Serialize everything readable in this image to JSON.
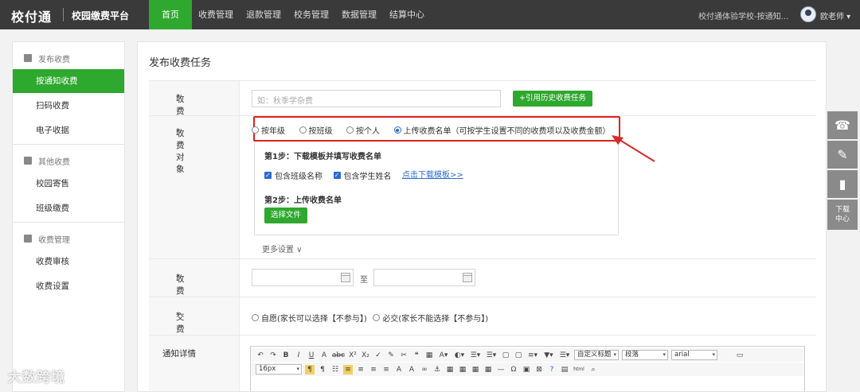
{
  "header": {
    "logo": "校付通",
    "platform": "校园缴费平台",
    "nav": [
      "首页",
      "收费管理",
      "退款管理",
      "校务管理",
      "数据管理",
      "结算中心"
    ],
    "school": "校付通体验学校-按通知...",
    "user": "欧老师 ▾"
  },
  "sidebar": {
    "groups": [
      {
        "label": "发布收费",
        "items": [
          "按通知收费",
          "扫码收费",
          "电子收据"
        ]
      },
      {
        "label": "其他收费",
        "items": [
          "校园寄售",
          "班级缴费"
        ]
      },
      {
        "label": "收费管理",
        "items": [
          "收费审核",
          "收费设置"
        ]
      }
    ]
  },
  "main": {
    "title": "发布收费任务",
    "task_name": {
      "label": "收费任务名称",
      "placeholder": "如：秋季学杂费",
      "history_button": "+引用历史收费任务"
    },
    "target": {
      "label": "收费对象",
      "options": [
        "按年级",
        "按班级",
        "按个人",
        "上传收费名单（可按学生设置不同的收费项以及收费金额）"
      ],
      "selected_index": 3
    },
    "upload": {
      "step1": "第1步：下载模板并填写收费名单",
      "check_class": "包含班级名称",
      "check_student": "包含学生姓名",
      "download_link": "点击下载模板>>",
      "step2": "第2步：上传收费名单",
      "select_button": "选择文件"
    },
    "more_settings": "更多设置 ∨",
    "date": {
      "label": "收费起止日期",
      "to": "至"
    },
    "mode": {
      "label": "交费形式",
      "optional": "自愿(家长可以选择【不参与】)",
      "mandatory": "必交(家长不能选择【不参与】)"
    },
    "detail": {
      "label": "通知详情"
    }
  },
  "editor": {
    "row1": [
      "↶",
      "↷",
      "B",
      "I",
      "U",
      "A",
      "abc",
      "X²",
      "X₂",
      "✓",
      "✎",
      "✂",
      "❝",
      "▦",
      "A▾",
      "◐▾",
      "☰▾",
      "☰▾",
      "▢",
      "▢",
      "≡▾",
      "▼▾",
      "☰▾"
    ],
    "heading_select": "自定义标题",
    "para_select": "段落",
    "font_select": "arial",
    "size_select": "16px",
    "row2": [
      "¶",
      "¶",
      "☷",
      "≡",
      "≡",
      "≡",
      "≡",
      "A",
      "A",
      "∞",
      "⚓",
      "▦",
      "▦",
      "▦",
      "▦",
      "—",
      "Ω",
      "▣",
      "⊠",
      "?",
      "▤",
      "html",
      "⌕"
    ]
  },
  "tools": {
    "download_center": "下载中心"
  },
  "watermark": "大数跨境"
}
